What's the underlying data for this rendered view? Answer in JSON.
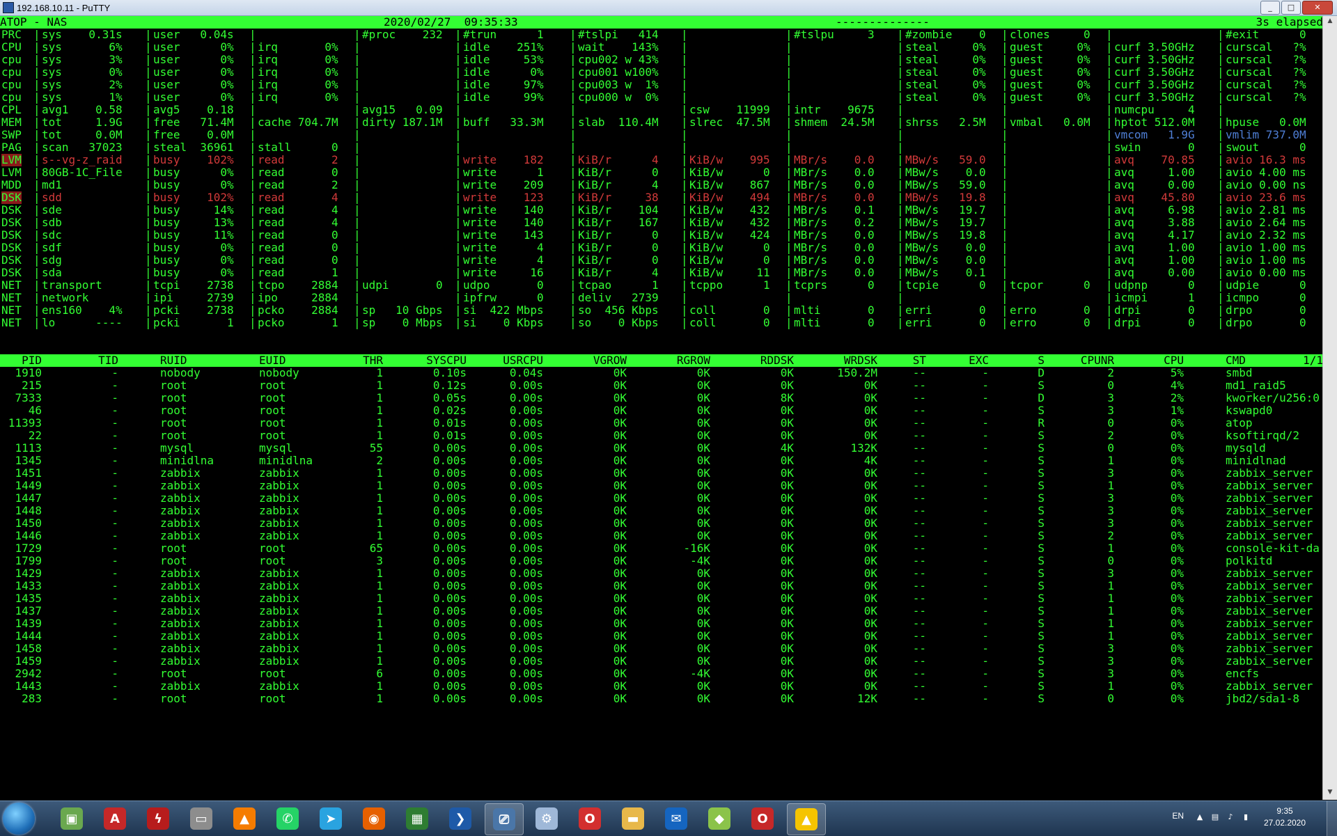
{
  "window": {
    "title": "192.168.10.11 - PuTTY",
    "controls": [
      "_",
      "□",
      "✕"
    ]
  },
  "colors": {
    "green": "#33ff33",
    "red": "#d23a3a",
    "blue": "#4f7fd6",
    "banner_text": "#000000"
  },
  "header": {
    "host": "ATOP - NAS",
    "datetime": "2020/02/27  09:35:33",
    "dashes": "--------------",
    "elapsed": "3s elapsed"
  },
  "sys_rows": [
    {
      "label": "PRC",
      "cells": [
        "sys    0.31s",
        "user   0.04s",
        "",
        "#proc    232",
        "#trun      1",
        "#tslpi   414",
        "",
        "#tslpu     3",
        "#zombie    0",
        "clones     0",
        "",
        "#exit      0"
      ]
    },
    {
      "label": "CPU",
      "cells": [
        "sys       6%",
        "user      0%",
        "irq       0%",
        "",
        "idle    251%",
        "wait    143%",
        "",
        "",
        "steal     0%",
        "guest     0%",
        "curf 3.50GHz",
        "curscal   ?%"
      ]
    },
    {
      "label": "cpu",
      "cells": [
        "sys       3%",
        "user      0%",
        "irq       0%",
        "",
        "idle     53%",
        "cpu002 w 43%",
        "",
        "",
        "steal     0%",
        "guest     0%",
        "curf 3.50GHz",
        "curscal   ?%"
      ]
    },
    {
      "label": "cpu",
      "cells": [
        "sys       0%",
        "user      0%",
        "irq       0%",
        "",
        "idle      0%",
        "cpu001 w100%",
        "",
        "",
        "steal     0%",
        "guest     0%",
        "curf 3.50GHz",
        "curscal   ?%"
      ]
    },
    {
      "label": "cpu",
      "cells": [
        "sys       2%",
        "user      0%",
        "irq       0%",
        "",
        "idle     97%",
        "cpu003 w  1%",
        "",
        "",
        "steal     0%",
        "guest     0%",
        "curf 3.50GHz",
        "curscal   ?%"
      ]
    },
    {
      "label": "cpu",
      "cells": [
        "sys       1%",
        "user      0%",
        "irq       0%",
        "",
        "idle     99%",
        "cpu000 w  0%",
        "",
        "",
        "steal     0%",
        "guest     0%",
        "curf 3.50GHz",
        "curscal   ?%"
      ]
    },
    {
      "label": "CPL",
      "cells": [
        "avg1    0.58",
        "avg5    0.18",
        "",
        "avg15   0.09",
        "",
        "",
        "csw    11999",
        "intr    9675",
        "",
        "",
        "numcpu     4",
        ""
      ]
    },
    {
      "label": "MEM",
      "cells": [
        "tot     1.9G",
        "free   71.4M",
        "cache 704.7M",
        "dirty 187.1M",
        "buff   33.3M",
        "slab  110.4M",
        "slrec  47.5M",
        "shmem  24.5M",
        "shrss   2.5M",
        "vmbal   0.0M",
        "hptot 512.0M",
        "hpuse   0.0M"
      ]
    },
    {
      "label": "SWP",
      "cells": [
        "tot     0.0M",
        "free    0.0M",
        "",
        "",
        "",
        "",
        "",
        "",
        "",
        "",
        "vmcom   1.9G",
        "vmlim 737.0M"
      ],
      "blue": [
        10,
        11
      ]
    },
    {
      "label": "PAG",
      "cells": [
        "scan   37023",
        "steal  36961",
        "stall      0",
        "",
        "",
        "",
        "",
        "",
        "",
        "",
        "swin       0",
        "swout      0"
      ]
    },
    {
      "label": "LVM",
      "red": true,
      "cells": [
        "s--vg-z_raid",
        "busy    102%",
        "read       2",
        "",
        "write    182",
        "KiB/r      4",
        "KiB/w    995",
        "MBr/s    0.0",
        "MBw/s   59.0",
        "",
        "avq    70.85",
        "avio 16.3 ms"
      ]
    },
    {
      "label": "LVM",
      "cells": [
        "80GB-1C_File",
        "busy      0%",
        "read       0",
        "",
        "write      1",
        "KiB/r      0",
        "KiB/w      0",
        "MBr/s    0.0",
        "MBw/s    0.0",
        "",
        "avq     1.00",
        "avio 4.00 ms"
      ]
    },
    {
      "label": "MDD",
      "cells": [
        "md1",
        "busy      0%",
        "read       2",
        "",
        "write    209",
        "KiB/r      4",
        "KiB/w    867",
        "MBr/s    0.0",
        "MBw/s   59.0",
        "",
        "avq     0.00",
        "avio 0.00 ns"
      ]
    },
    {
      "label": "DSK",
      "red": true,
      "cells": [
        "sdd",
        "busy    102%",
        "read       4",
        "",
        "write    123",
        "KiB/r     38",
        "KiB/w    494",
        "MBr/s    0.0",
        "MBw/s   19.8",
        "",
        "avq    45.80",
        "avio 23.6 ms"
      ]
    },
    {
      "label": "DSK",
      "cells": [
        "sde",
        "busy     14%",
        "read       4",
        "",
        "write    140",
        "KiB/r    104",
        "KiB/w    432",
        "MBr/s    0.1",
        "MBw/s   19.7",
        "",
        "avq     6.98",
        "avio 2.81 ms"
      ]
    },
    {
      "label": "DSK",
      "cells": [
        "sdb",
        "busy     13%",
        "read       4",
        "",
        "write    140",
        "KiB/r    167",
        "KiB/w    432",
        "MBr/s    0.2",
        "MBw/s   19.7",
        "",
        "avq     3.88",
        "avio 2.64 ms"
      ]
    },
    {
      "label": "DSK",
      "cells": [
        "sdc",
        "busy     11%",
        "read       0",
        "",
        "write    143",
        "KiB/r      0",
        "KiB/w    424",
        "MBr/s    0.0",
        "MBw/s   19.8",
        "",
        "avq     4.17",
        "avio 2.32 ms"
      ]
    },
    {
      "label": "DSK",
      "cells": [
        "sdf",
        "busy      0%",
        "read       0",
        "",
        "write      4",
        "KiB/r      0",
        "KiB/w      0",
        "MBr/s    0.0",
        "MBw/s    0.0",
        "",
        "avq     1.00",
        "avio 1.00 ms"
      ]
    },
    {
      "label": "DSK",
      "cells": [
        "sdg",
        "busy      0%",
        "read       0",
        "",
        "write      4",
        "KiB/r      0",
        "KiB/w      0",
        "MBr/s    0.0",
        "MBw/s    0.0",
        "",
        "avq     1.00",
        "avio 1.00 ms"
      ]
    },
    {
      "label": "DSK",
      "cells": [
        "sda",
        "busy      0%",
        "read       1",
        "",
        "write     16",
        "KiB/r      4",
        "KiB/w     11",
        "MBr/s    0.0",
        "MBw/s    0.1",
        "",
        "avq     0.00",
        "avio 0.00 ms"
      ]
    },
    {
      "label": "NET",
      "cells": [
        "transport",
        "tcpi    2738",
        "tcpo    2884",
        "udpi       0",
        "udpo       0",
        "tcpao      1",
        "tcppo      1",
        "tcprs      0",
        "tcpie      0",
        "tcpor      0",
        "udpnp      0",
        "udpie      0"
      ]
    },
    {
      "label": "NET",
      "cells": [
        "network",
        "ipi     2739",
        "ipo     2884",
        "",
        "ipfrw      0",
        "deliv   2739",
        "",
        "",
        "",
        "",
        "icmpi      1",
        "icmpo      0"
      ]
    },
    {
      "label": "NET",
      "cells": [
        "ens160    4%",
        "pcki    2738",
        "pcko    2884",
        "sp   10 Gbps",
        "si  422 Mbps",
        "so  456 Kbps",
        "coll       0",
        "mlti       0",
        "erri       0",
        "erro       0",
        "drpi       0",
        "drpo       0"
      ]
    },
    {
      "label": "NET",
      "cells": [
        "lo      ----",
        "pcki       1",
        "pcko       1",
        "sp    0 Mbps",
        "si    0 Kbps",
        "so    0 Kbps",
        "coll       0",
        "mlti       0",
        "erri       0",
        "erro       0",
        "drpi       0",
        "drpo       0"
      ]
    }
  ],
  "proc_header": {
    "columns": [
      "PID",
      "TID",
      "RUID",
      "EUID",
      "THR",
      "SYSCPU",
      "USRCPU",
      "VGROW",
      "RGROW",
      "RDDSK",
      "WRDSK",
      "ST",
      "EXC",
      "S",
      "CPUNR",
      "CPU",
      "CMD"
    ],
    "page": "1/1"
  },
  "processes": [
    [
      "1910",
      "-",
      "nobody",
      "nobody",
      "1",
      "0.10s",
      "0.04s",
      "0K",
      "0K",
      "0K",
      "150.2M",
      "--",
      "-",
      "D",
      "2",
      "5%",
      "smbd"
    ],
    [
      "215",
      "-",
      "root",
      "root",
      "1",
      "0.12s",
      "0.00s",
      "0K",
      "0K",
      "0K",
      "0K",
      "--",
      "-",
      "S",
      "0",
      "4%",
      "md1_raid5"
    ],
    [
      "7333",
      "-",
      "root",
      "root",
      "1",
      "0.05s",
      "0.00s",
      "0K",
      "0K",
      "8K",
      "0K",
      "--",
      "-",
      "D",
      "3",
      "2%",
      "kworker/u256:0"
    ],
    [
      "46",
      "-",
      "root",
      "root",
      "1",
      "0.02s",
      "0.00s",
      "0K",
      "0K",
      "0K",
      "0K",
      "--",
      "-",
      "S",
      "3",
      "1%",
      "kswapd0"
    ],
    [
      "11393",
      "-",
      "root",
      "root",
      "1",
      "0.01s",
      "0.00s",
      "0K",
      "0K",
      "0K",
      "0K",
      "--",
      "-",
      "R",
      "0",
      "0%",
      "atop"
    ],
    [
      "22",
      "-",
      "root",
      "root",
      "1",
      "0.01s",
      "0.00s",
      "0K",
      "0K",
      "0K",
      "0K",
      "--",
      "-",
      "S",
      "2",
      "0%",
      "ksoftirqd/2"
    ],
    [
      "1113",
      "-",
      "mysql",
      "mysql",
      "55",
      "0.00s",
      "0.00s",
      "0K",
      "0K",
      "4K",
      "132K",
      "--",
      "-",
      "S",
      "0",
      "0%",
      "mysqld"
    ],
    [
      "1345",
      "-",
      "minidlna",
      "minidlna",
      "2",
      "0.00s",
      "0.00s",
      "0K",
      "0K",
      "0K",
      "4K",
      "--",
      "-",
      "S",
      "1",
      "0%",
      "minidlnad"
    ],
    [
      "1451",
      "-",
      "zabbix",
      "zabbix",
      "1",
      "0.00s",
      "0.00s",
      "0K",
      "0K",
      "0K",
      "0K",
      "--",
      "-",
      "S",
      "3",
      "0%",
      "zabbix_server"
    ],
    [
      "1449",
      "-",
      "zabbix",
      "zabbix",
      "1",
      "0.00s",
      "0.00s",
      "0K",
      "0K",
      "0K",
      "0K",
      "--",
      "-",
      "S",
      "1",
      "0%",
      "zabbix_server"
    ],
    [
      "1447",
      "-",
      "zabbix",
      "zabbix",
      "1",
      "0.00s",
      "0.00s",
      "0K",
      "0K",
      "0K",
      "0K",
      "--",
      "-",
      "S",
      "3",
      "0%",
      "zabbix_server"
    ],
    [
      "1448",
      "-",
      "zabbix",
      "zabbix",
      "1",
      "0.00s",
      "0.00s",
      "0K",
      "0K",
      "0K",
      "0K",
      "--",
      "-",
      "S",
      "3",
      "0%",
      "zabbix_server"
    ],
    [
      "1450",
      "-",
      "zabbix",
      "zabbix",
      "1",
      "0.00s",
      "0.00s",
      "0K",
      "0K",
      "0K",
      "0K",
      "--",
      "-",
      "S",
      "3",
      "0%",
      "zabbix_server"
    ],
    [
      "1446",
      "-",
      "zabbix",
      "zabbix",
      "1",
      "0.00s",
      "0.00s",
      "0K",
      "0K",
      "0K",
      "0K",
      "--",
      "-",
      "S",
      "2",
      "0%",
      "zabbix_server"
    ],
    [
      "1729",
      "-",
      "root",
      "root",
      "65",
      "0.00s",
      "0.00s",
      "0K",
      "-16K",
      "0K",
      "0K",
      "--",
      "-",
      "S",
      "1",
      "0%",
      "console-kit-da"
    ],
    [
      "1799",
      "-",
      "root",
      "root",
      "3",
      "0.00s",
      "0.00s",
      "0K",
      "-4K",
      "0K",
      "0K",
      "--",
      "-",
      "S",
      "0",
      "0%",
      "polkitd"
    ],
    [
      "1429",
      "-",
      "zabbix",
      "zabbix",
      "1",
      "0.00s",
      "0.00s",
      "0K",
      "0K",
      "0K",
      "0K",
      "--",
      "-",
      "S",
      "3",
      "0%",
      "zabbix_server"
    ],
    [
      "1433",
      "-",
      "zabbix",
      "zabbix",
      "1",
      "0.00s",
      "0.00s",
      "0K",
      "0K",
      "0K",
      "0K",
      "--",
      "-",
      "S",
      "1",
      "0%",
      "zabbix_server"
    ],
    [
      "1435",
      "-",
      "zabbix",
      "zabbix",
      "1",
      "0.00s",
      "0.00s",
      "0K",
      "0K",
      "0K",
      "0K",
      "--",
      "-",
      "S",
      "1",
      "0%",
      "zabbix_server"
    ],
    [
      "1437",
      "-",
      "zabbix",
      "zabbix",
      "1",
      "0.00s",
      "0.00s",
      "0K",
      "0K",
      "0K",
      "0K",
      "--",
      "-",
      "S",
      "1",
      "0%",
      "zabbix_server"
    ],
    [
      "1439",
      "-",
      "zabbix",
      "zabbix",
      "1",
      "0.00s",
      "0.00s",
      "0K",
      "0K",
      "0K",
      "0K",
      "--",
      "-",
      "S",
      "1",
      "0%",
      "zabbix_server"
    ],
    [
      "1444",
      "-",
      "zabbix",
      "zabbix",
      "1",
      "0.00s",
      "0.00s",
      "0K",
      "0K",
      "0K",
      "0K",
      "--",
      "-",
      "S",
      "1",
      "0%",
      "zabbix_server"
    ],
    [
      "1458",
      "-",
      "zabbix",
      "zabbix",
      "1",
      "0.00s",
      "0.00s",
      "0K",
      "0K",
      "0K",
      "0K",
      "--",
      "-",
      "S",
      "3",
      "0%",
      "zabbix_server"
    ],
    [
      "1459",
      "-",
      "zabbix",
      "zabbix",
      "1",
      "0.00s",
      "0.00s",
      "0K",
      "0K",
      "0K",
      "0K",
      "--",
      "-",
      "S",
      "3",
      "0%",
      "zabbix_server"
    ],
    [
      "2942",
      "-",
      "root",
      "root",
      "6",
      "0.00s",
      "0.00s",
      "0K",
      "-4K",
      "0K",
      "0K",
      "--",
      "-",
      "S",
      "3",
      "0%",
      "encfs"
    ],
    [
      "1443",
      "-",
      "zabbix",
      "zabbix",
      "1",
      "0.00s",
      "0.00s",
      "0K",
      "0K",
      "0K",
      "0K",
      "--",
      "-",
      "S",
      "1",
      "0%",
      "zabbix_server"
    ],
    [
      "283",
      "-",
      "root",
      "root",
      "1",
      "0.00s",
      "0.00s",
      "0K",
      "0K",
      "0K",
      "12K",
      "--",
      "-",
      "S",
      "0",
      "0%",
      "jbd2/sda1-8"
    ]
  ],
  "taskbar": {
    "apps": [
      {
        "icon": "putty-green-icon",
        "color": "#6aa84f"
      },
      {
        "icon": "acrobat-icon",
        "color": "#c62828"
      },
      {
        "icon": "pdf-tool-icon",
        "color": "#b71c1c"
      },
      {
        "icon": "scanner-icon",
        "color": "#8d8d8d"
      },
      {
        "icon": "vlc-icon",
        "color": "#f57c00"
      },
      {
        "icon": "whatsapp-icon",
        "color": "#25d366"
      },
      {
        "icon": "telegram-icon",
        "color": "#2aa3e0"
      },
      {
        "icon": "firefox-icon",
        "color": "#e66000"
      },
      {
        "icon": "excel-icon",
        "color": "#2e7d32"
      },
      {
        "icon": "powershell-icon",
        "color": "#1e5aa8"
      },
      {
        "icon": "putty-icon",
        "color": "#4a76a8",
        "active": true
      },
      {
        "icon": "network-tool-icon",
        "color": "#9fb8d8"
      },
      {
        "icon": "opera-icon",
        "color": "#d32f2f"
      },
      {
        "icon": "folder-icon",
        "color": "#e8b84a"
      },
      {
        "icon": "outlook-icon",
        "color": "#1565c0"
      },
      {
        "icon": "android-icon",
        "color": "#8bc34a"
      },
      {
        "icon": "opera-red-icon",
        "color": "#c62828"
      },
      {
        "icon": "atop-app-icon",
        "color": "#f5c400",
        "active": true
      }
    ],
    "lang": "EN",
    "time": "9:35",
    "date": "27.02.2020"
  }
}
